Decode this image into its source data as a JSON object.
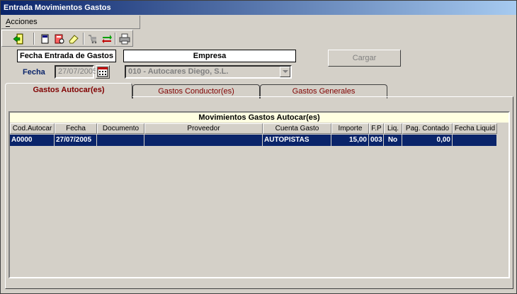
{
  "window": {
    "title": "Entrada Movimientos Gastos"
  },
  "menu": {
    "acciones": "Acciones"
  },
  "toolbar": {
    "icons": [
      "exit-icon",
      "new-doc-icon",
      "print-preview-icon",
      "eraser-icon",
      "cart-icon",
      "transfer-icon",
      "printer-icon"
    ]
  },
  "header": {
    "fecha_entrada_label": "Fecha Entrada de Gastos",
    "empresa_label": "Empresa",
    "fecha_label": "Fecha",
    "fecha_value": "27/07/2005",
    "empresa_value": "010 - Autocares Diego, S.L.",
    "cargar_label": "Cargar"
  },
  "tabs": [
    {
      "label": "Gastos Autocar(es)",
      "active": true
    },
    {
      "label": "Gastos Conductor(es)",
      "active": false
    },
    {
      "label": "Gastos Generales",
      "active": false
    }
  ],
  "grid": {
    "title": "Movimientos Gastos Autocar(es)",
    "columns": [
      "Cod.Autocar",
      "Fecha",
      "Documento",
      "Proveedor",
      "Cuenta Gasto",
      "Importe",
      "F.P",
      "Liq.",
      "Pag. Contado",
      "Fecha Liquid"
    ],
    "rows": [
      [
        "A0000",
        "27/07/2005",
        "",
        "",
        "AUTOPISTAS",
        "15,00",
        "003",
        "No",
        "0,00",
        ""
      ]
    ]
  }
}
